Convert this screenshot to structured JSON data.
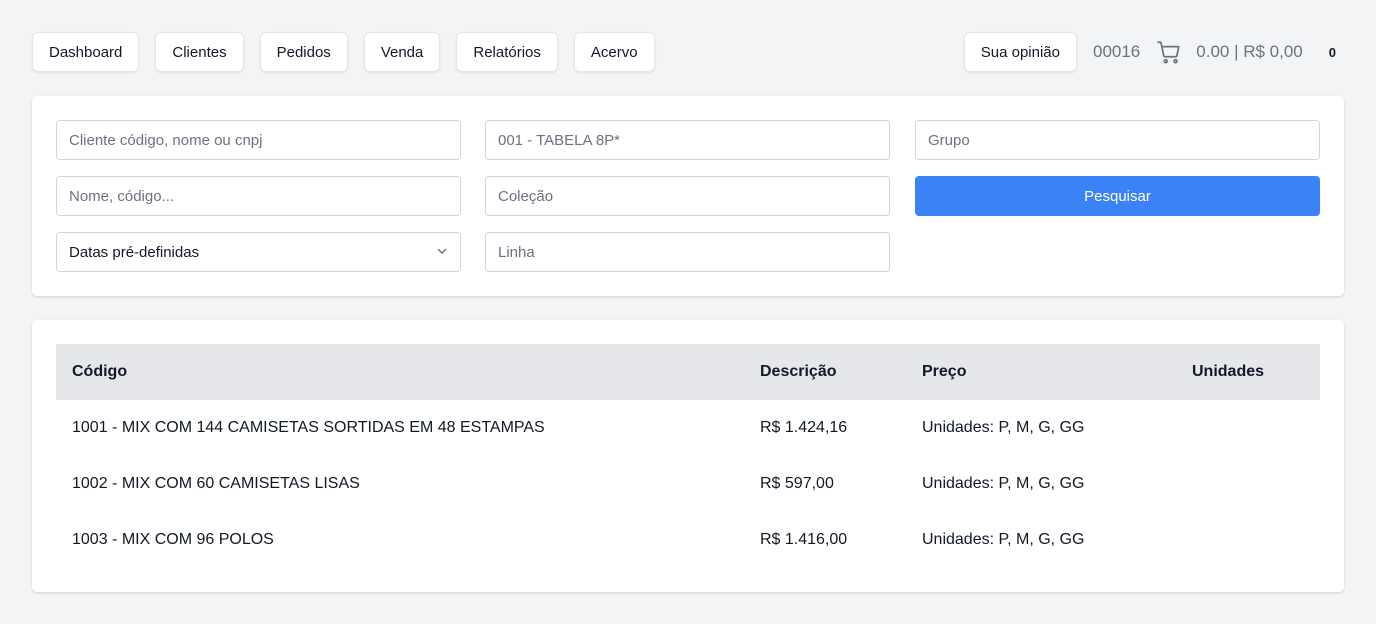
{
  "nav": {
    "items": [
      "Dashboard",
      "Clientes",
      "Pedidos",
      "Venda",
      "Relatórios",
      "Acervo"
    ],
    "feedback_label": "Sua opinião",
    "order_number": "00016",
    "cart_icon": "cart-icon",
    "cart_total": "0.00 | R$ 0,00",
    "cart_count": "0"
  },
  "filters": {
    "client_placeholder": "Cliente código, nome ou cnpj",
    "table_placeholder": "001 - TABELA 8P*",
    "group_placeholder": "Grupo",
    "name_placeholder": "Nome, código...",
    "collection_placeholder": "Coleção",
    "search_label": "Pesquisar",
    "dates_selected": "Datas pré-definidas",
    "line_placeholder": "Linha"
  },
  "table": {
    "headers": [
      "Código",
      "Descrição",
      "Preço",
      "Unidades"
    ],
    "rows": [
      [
        "1001 - MIX COM 144 CAMISETAS SORTIDAS EM 48 ESTAMPAS",
        "R$ 1.424,16",
        "Unidades: P, M, G, GG",
        ""
      ],
      [
        "1002 - MIX COM 60 CAMISETAS LISAS",
        "R$ 597,00",
        "Unidades: P, M, G, GG",
        ""
      ],
      [
        "1003 - MIX COM 96 POLOS",
        "R$ 1.416,00",
        "Unidades: P, M, G, GG",
        ""
      ]
    ]
  },
  "colors": {
    "primary": "#3b82f6",
    "background": "#f3f4f6",
    "header_row": "#e5e7eb"
  }
}
